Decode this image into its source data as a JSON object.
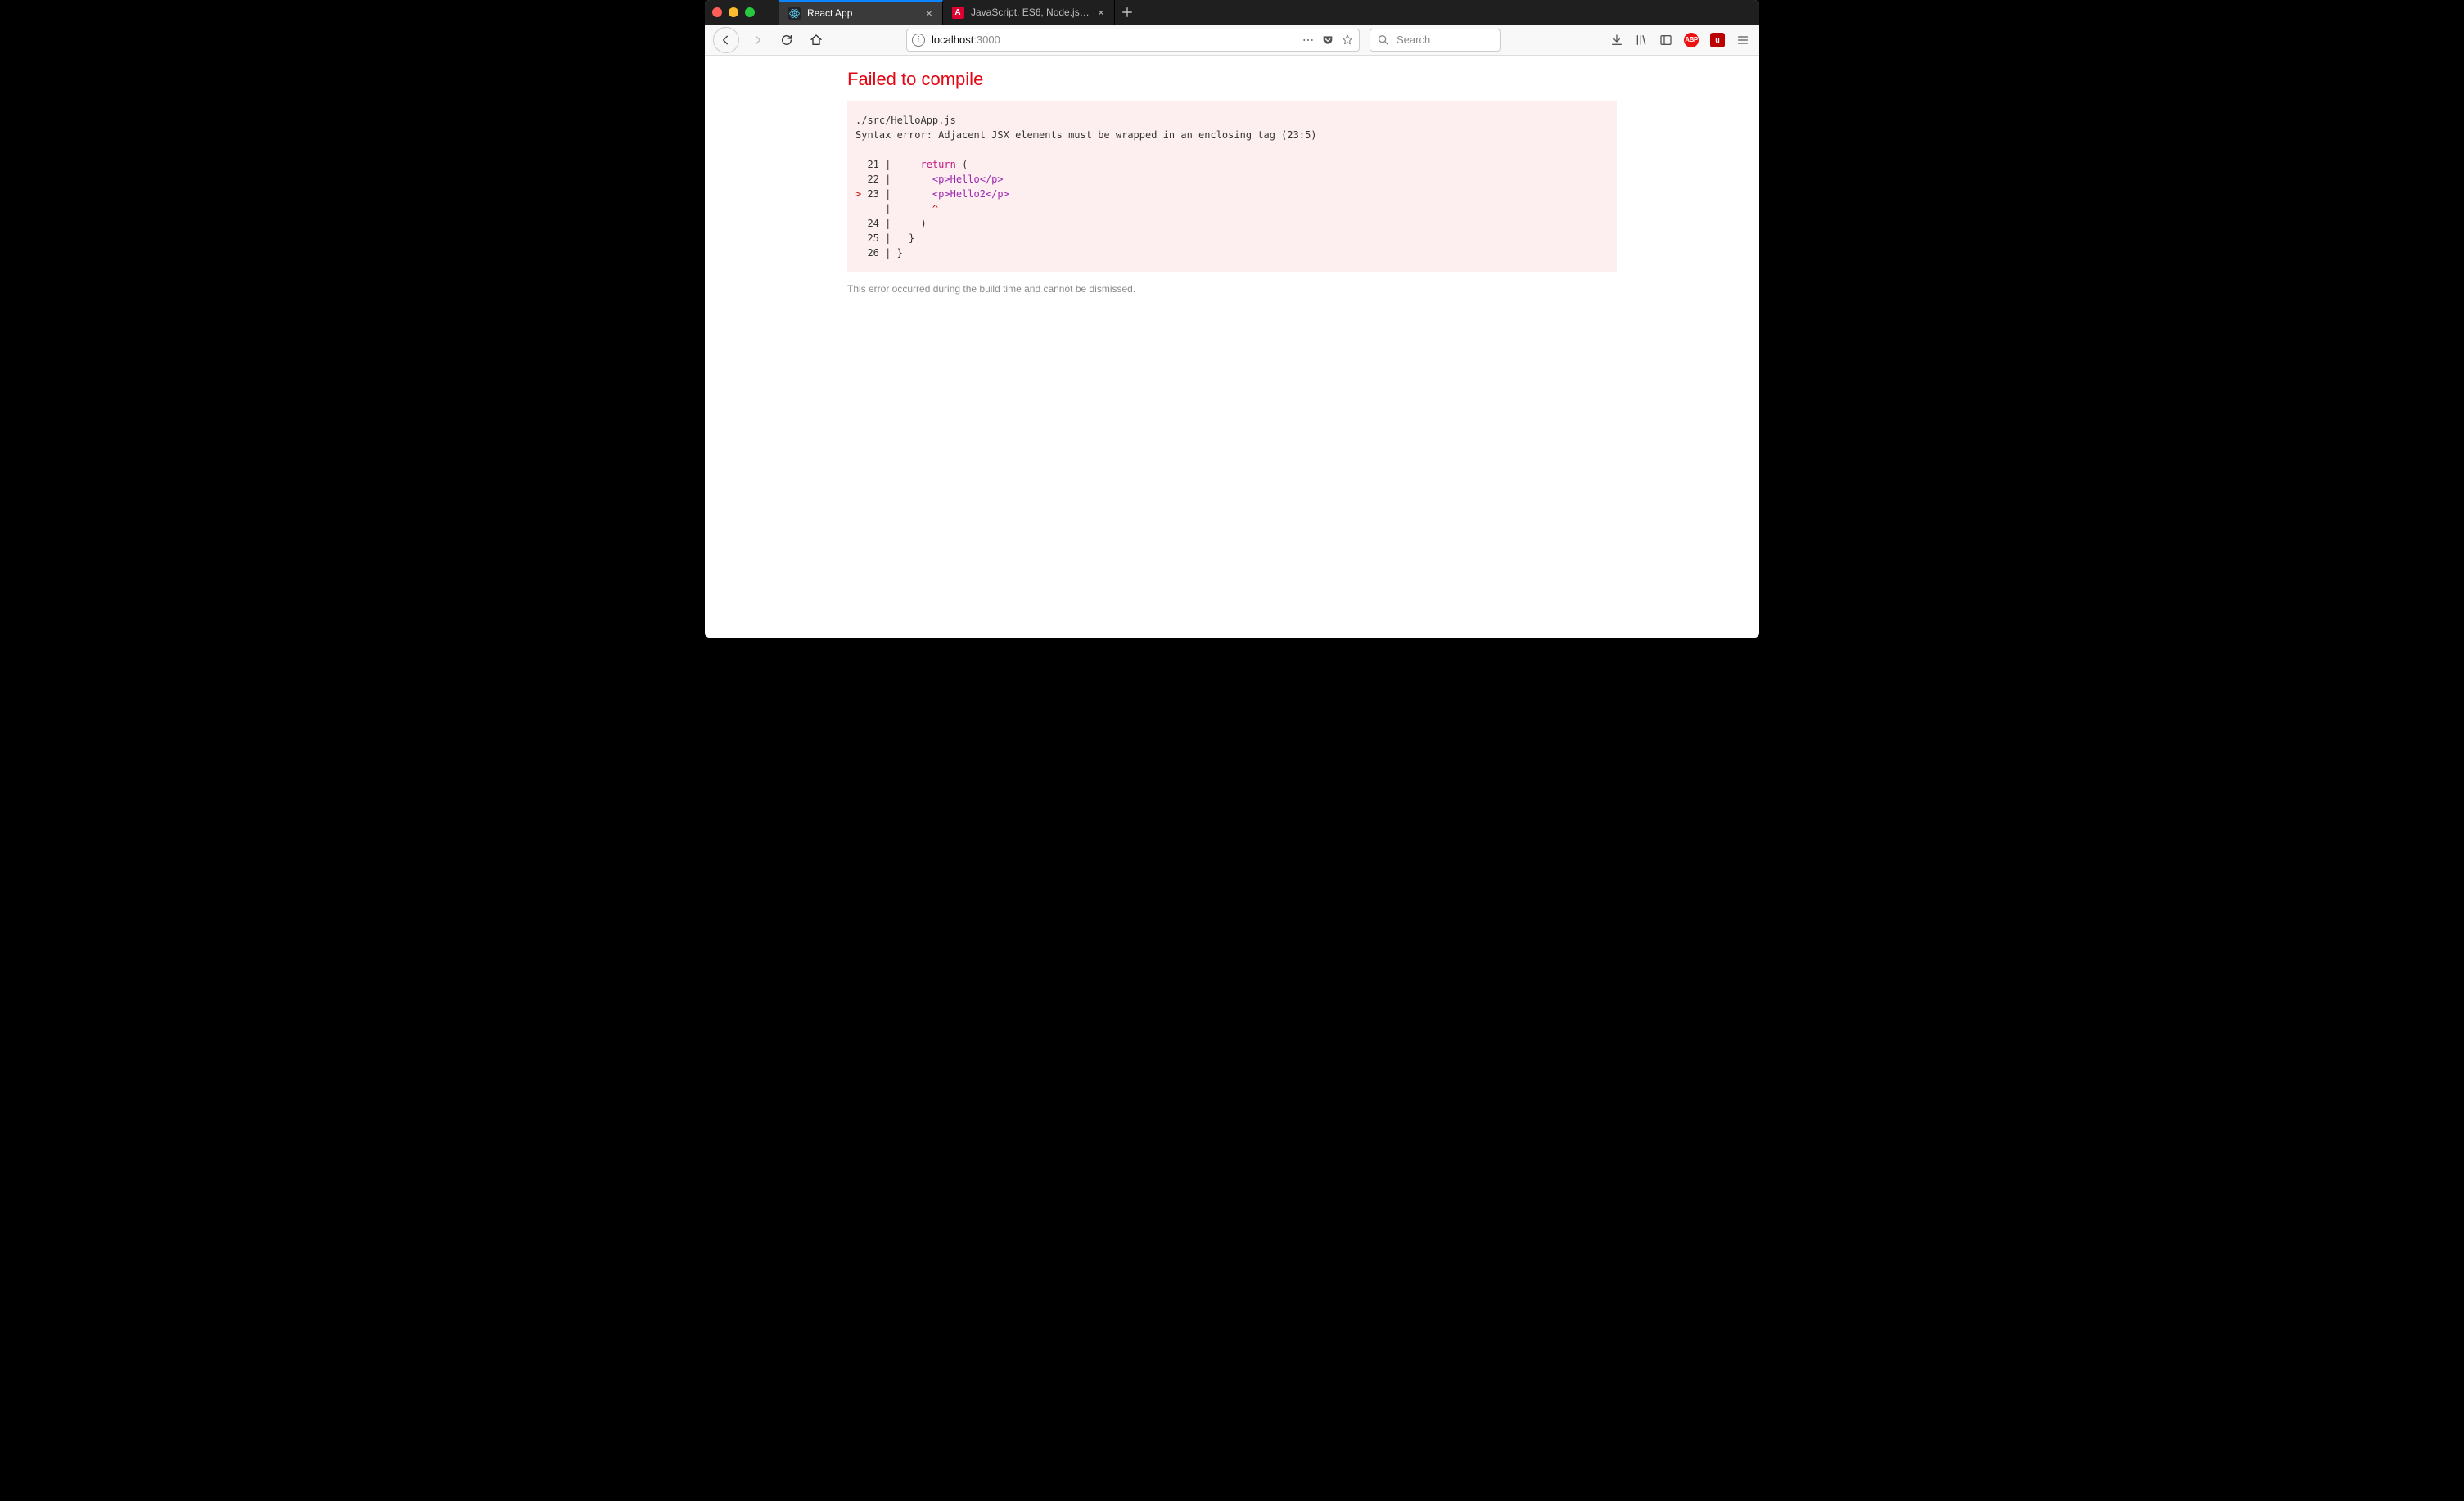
{
  "tabs": [
    {
      "title": "React App",
      "active": true,
      "favicon": "react"
    },
    {
      "title": "JavaScript, ES6, Node.js, Angu",
      "active": false,
      "favicon": "angular"
    }
  ],
  "url": {
    "host": "localhost",
    "port": ":3000"
  },
  "search": {
    "placeholder": "Search"
  },
  "toolbar_icons": {
    "abp": "ABP",
    "ub": "u"
  },
  "error": {
    "title": "Failed to compile",
    "file": "./src/HelloApp.js",
    "message": "Syntax error: Adjacent JSX elements must be wrapped in an enclosing tag (23:5)",
    "lines": [
      {
        "marker": " ",
        "num": "21",
        "pre": "    ",
        "kw": "return",
        "post": " ("
      },
      {
        "marker": " ",
        "num": "22",
        "pre": "      ",
        "html": "<p>Hello</p>"
      },
      {
        "marker": ">",
        "num": "23",
        "pre": "      ",
        "html": "<p>Hello2</p>"
      },
      {
        "marker": " ",
        "num": "  ",
        "pre": "      ",
        "caret": "^"
      },
      {
        "marker": " ",
        "num": "24",
        "pre": "    ",
        "post": ")"
      },
      {
        "marker": " ",
        "num": "25",
        "pre": "  ",
        "post": "}"
      },
      {
        "marker": " ",
        "num": "26",
        "pre": "",
        "post": "}"
      }
    ],
    "footer": "This error occurred during the build time and cannot be dismissed."
  }
}
